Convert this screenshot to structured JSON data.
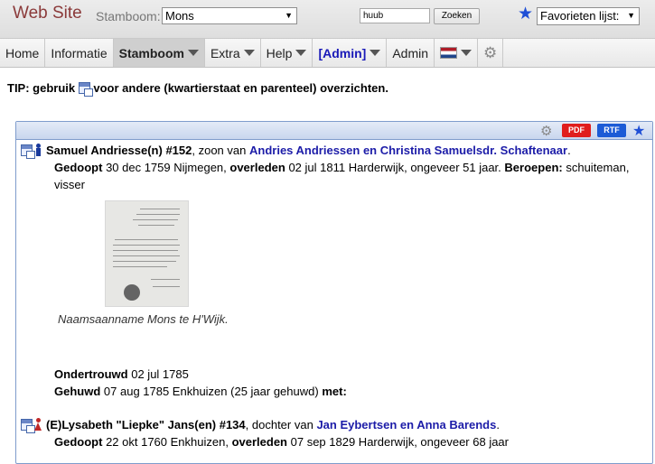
{
  "header": {
    "site_title": "Web Site",
    "tree_label": "Stamboom:",
    "tree_select": "Mons",
    "search_value": "huub",
    "search_button": "Zoeken",
    "favorites_select": "Favorieten lijst:"
  },
  "menu": {
    "items": [
      {
        "label": "Home"
      },
      {
        "label": "Informatie"
      },
      {
        "label": "Stamboom"
      },
      {
        "label": "Extra"
      },
      {
        "label": "Help"
      },
      {
        "label": "[Admin]"
      },
      {
        "label": "Admin"
      }
    ]
  },
  "tip": {
    "prefix": "TIP: gebruik",
    "suffix": "voor andere (kwartierstaat en parenteel) overzichten."
  },
  "panel": {
    "pdf_label": "PDF",
    "rtf_label": "RTF",
    "person1": {
      "name": "Samuel Andriesse(n) #152",
      "relation": ", zoon van",
      "parents": "Andries Andriessen en Christina Samuelsdr. Schaftenaar",
      "dot": ".",
      "baptised_label": "Gedoopt",
      "baptised_text": "30 dec 1759 Nijmegen,",
      "died_label": "overleden",
      "died_text": "02 jul 1811 Harderwijk, ongeveer 51 jaar.",
      "jobs_label": "Beroepen:",
      "jobs_text": "schuiteman, visser",
      "photo_caption": "Naamsaanname Mons te H'Wijk."
    },
    "marriage": {
      "banns_label": "Ondertrouwd",
      "banns_text": "02 jul 1785",
      "married_label": "Gehuwd",
      "married_text": "07 aug 1785 Enkhuizen (25 jaar gehuwd)",
      "with_label": "met:"
    },
    "person2": {
      "name": "(E)Lysabeth \"Liepke\" Jans(en) #134",
      "relation": ", dochter van",
      "parents": "Jan Eybertsen en Anna Barends",
      "dot": ".",
      "baptised_label": "Gedoopt",
      "baptised_text": "22 okt 1760 Enkhuizen,",
      "died_label": "overleden",
      "died_text": "07 sep 1829 Harderwijk, ongeveer 68 jaar"
    }
  }
}
